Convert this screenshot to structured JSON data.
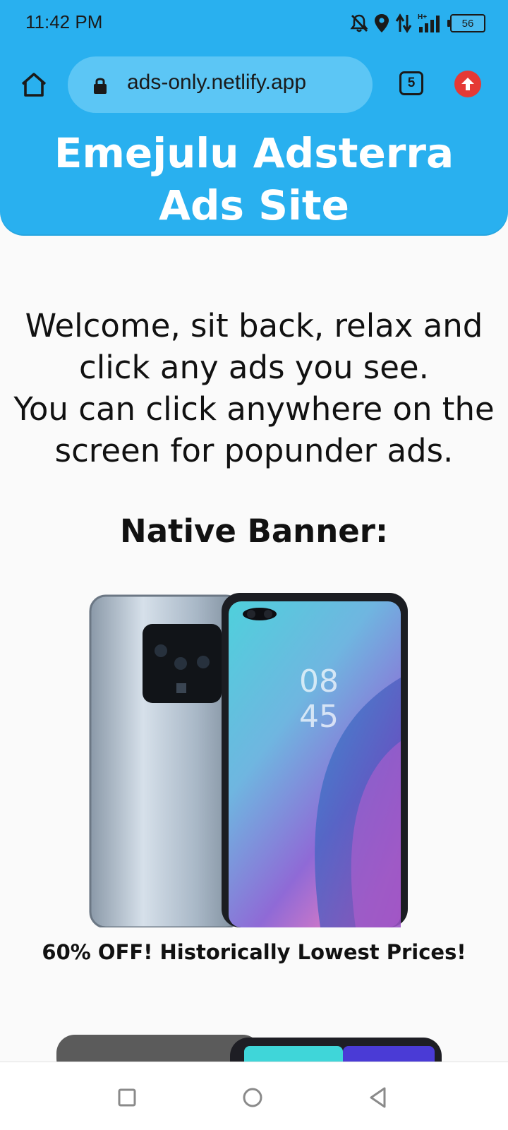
{
  "status_bar": {
    "time": "11:42 PM",
    "battery_level": "56",
    "icons": [
      "mute-icon",
      "location-icon",
      "data-transfer-icon",
      "signal-icon",
      "battery-icon"
    ]
  },
  "browser": {
    "url": "ads-only.netlify.app",
    "tab_count": "5",
    "icons": [
      "home-icon",
      "lock-icon",
      "tabs-icon",
      "update-icon"
    ]
  },
  "page": {
    "site_title": "Emejulu Adsterra Ads Site",
    "welcome_line_1": "Welcome, sit back, relax and click any ads you see.",
    "welcome_line_2": "You can click anywhere on the screen for popunder ads.",
    "native_banner_heading": "Native Banner:",
    "ad": {
      "caption": "60% OFF! Historically Lowest Prices!",
      "image": "smartphone-product-image"
    }
  },
  "nav_bar": {
    "icons": [
      "recents-icon",
      "home-nav-icon",
      "back-icon"
    ]
  },
  "colors": {
    "accent": "#29b0ef",
    "url_pill": "#5cc6f5",
    "update_badge": "#e53935",
    "page_background": "#fafafa"
  }
}
